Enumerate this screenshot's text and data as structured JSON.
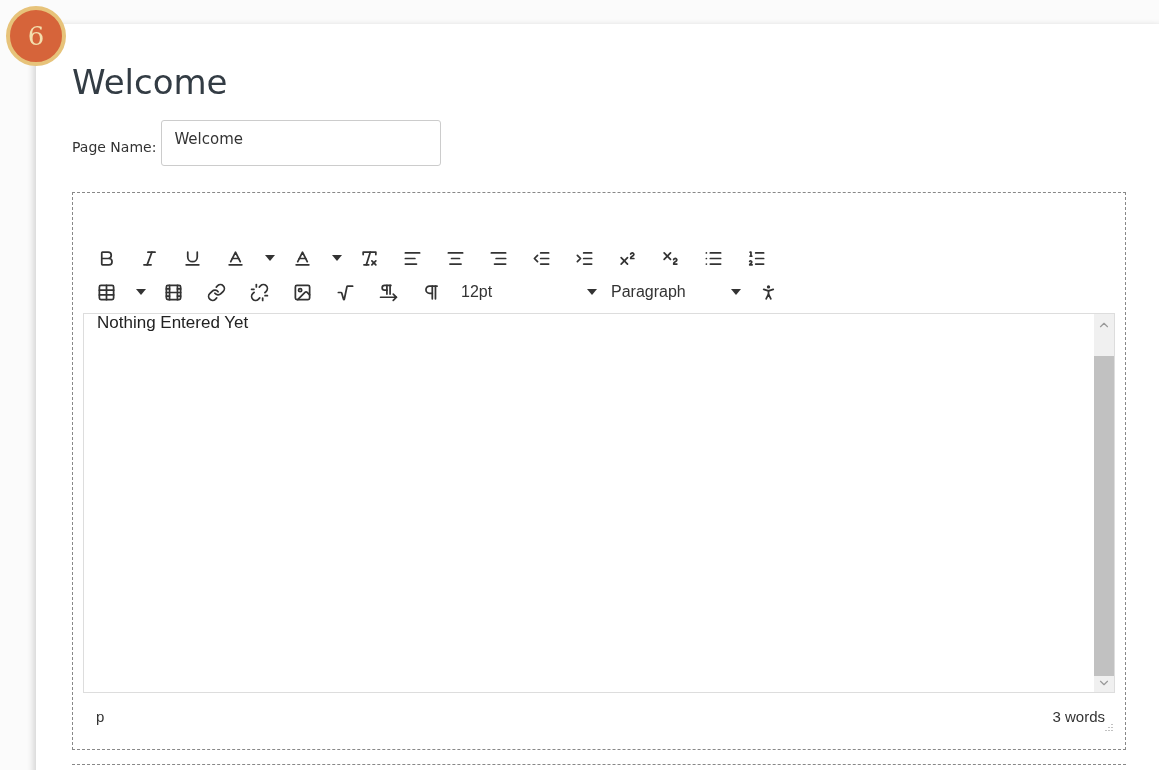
{
  "step_badge": "6",
  "heading": "Welcome",
  "page_name": {
    "label": "Page Name:",
    "value": "Welcome"
  },
  "editor": {
    "font_size": "12pt",
    "block_format": "Paragraph",
    "content": "Nothing Entered Yet",
    "path": "p",
    "word_count": "3 words"
  }
}
